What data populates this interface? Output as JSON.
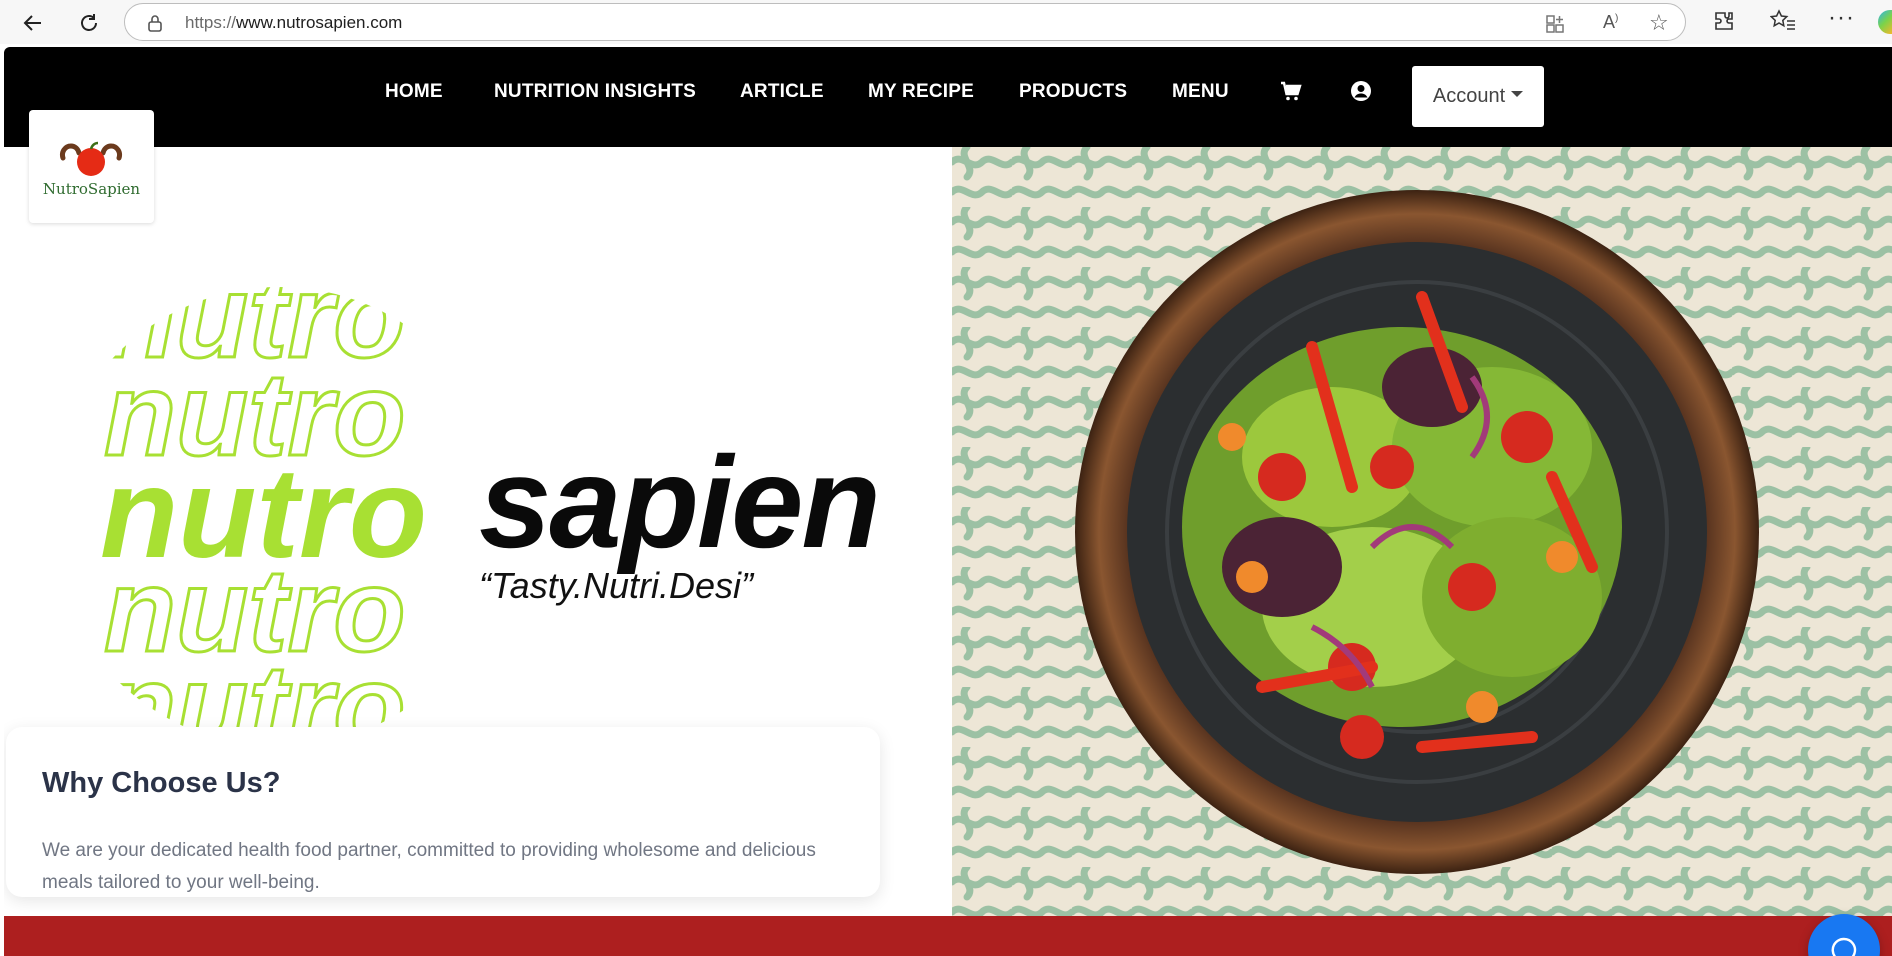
{
  "browser": {
    "url_scheme": "https://",
    "url_host": "www.nutrosapien.com"
  },
  "nav": {
    "items": [
      {
        "label": "HOME"
      },
      {
        "label": "NUTRITION INSIGHTS"
      },
      {
        "label": "ARTICLE"
      },
      {
        "label": "MY RECIPE"
      },
      {
        "label": "PRODUCTS"
      },
      {
        "label": "MENU"
      }
    ],
    "cart_icon": "cart-icon",
    "user_icon": "user-circle-icon",
    "account_label": "Account"
  },
  "logo": {
    "text": "NutroSapien"
  },
  "hero": {
    "word_nutro": "nutro",
    "word_sapien": "sapien",
    "tagline": "“Tasty.Nutri.Desi”",
    "accent_color": "#a8e033"
  },
  "why": {
    "title": "Why Choose Us?",
    "body": "We are your dedicated health food partner, committed to providing wholesome and delicious meals tailored to your well-being."
  },
  "colors": {
    "nav_bg": "#000000",
    "band": "#ad1f1f",
    "chat": "#1878f2"
  }
}
